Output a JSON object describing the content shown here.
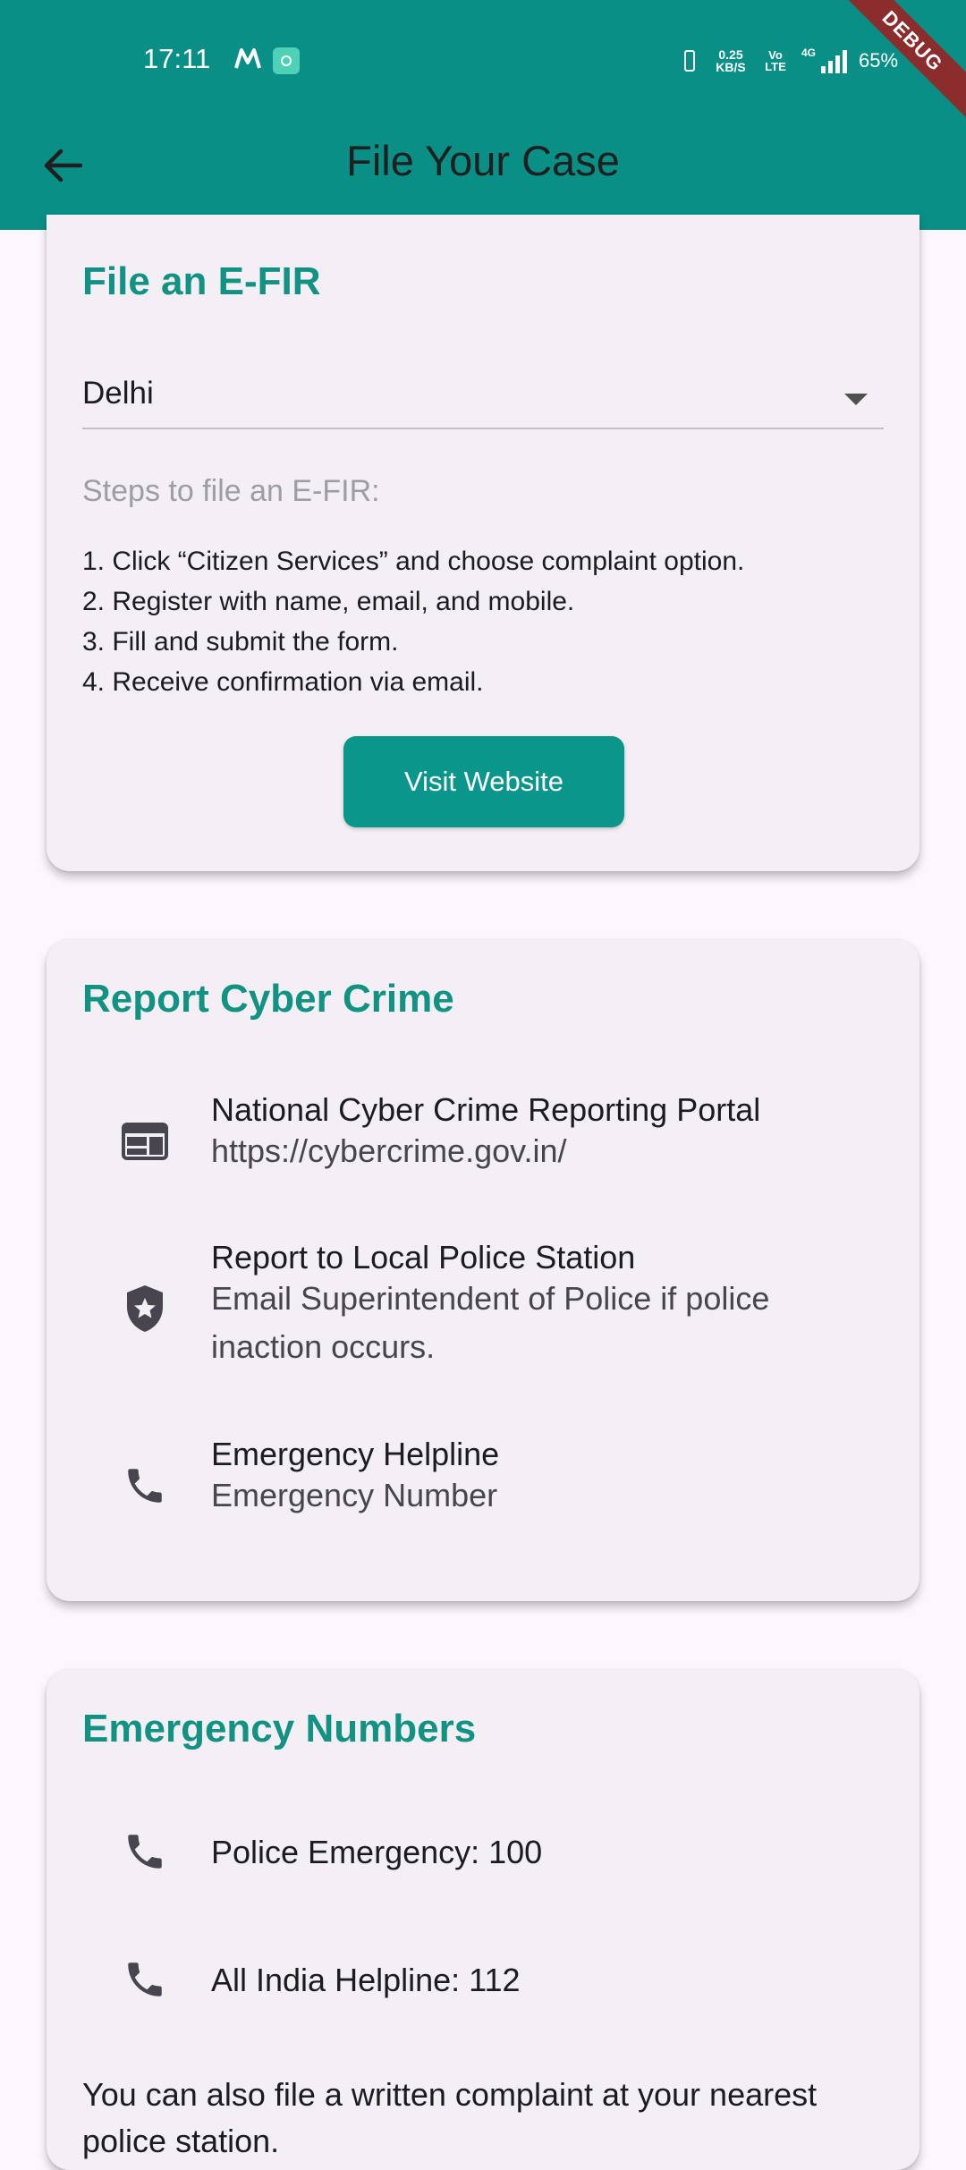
{
  "status_bar": {
    "time": "17:11",
    "speed": "0.25 KB/S",
    "volte": "Vo LTE",
    "network": "4G",
    "battery": "65%",
    "debug_label": "DEBUG"
  },
  "app_bar": {
    "title": "File Your Case",
    "back_icon": "arrow-back-icon",
    "background_color": "#0a8f87"
  },
  "efir_card": {
    "title": "File an E-FIR",
    "state_select": {
      "value": "Delhi"
    },
    "steps_label": "Steps to file an E-FIR:",
    "steps": [
      "1. Click “Citizen Services” and choose complaint option.",
      "2. Register with name, email, and mobile.",
      "3. Fill and submit the form.",
      "4. Receive confirmation via email."
    ],
    "button_label": "Visit Website"
  },
  "cyber_card": {
    "title": "Report Cyber Crime",
    "items": [
      {
        "icon": "web-icon",
        "title": "National Cyber Crime Reporting Portal",
        "subtitle": "https://cybercrime.gov.in/"
      },
      {
        "icon": "police-shield-icon",
        "title": "Report to Local Police Station",
        "subtitle": "Email Superintendent of Police if police inaction occurs."
      },
      {
        "icon": "phone-icon",
        "title": "Emergency Helpline",
        "subtitle": "Emergency Number"
      }
    ]
  },
  "emergency_card": {
    "title": "Emergency Numbers",
    "items": [
      {
        "icon": "phone-icon",
        "title": "Police Emergency: 100"
      },
      {
        "icon": "phone-icon",
        "title": "All India Helpline: 112"
      }
    ],
    "note": "You can also file a written complaint at your nearest police station."
  },
  "accent_color": "#119283"
}
